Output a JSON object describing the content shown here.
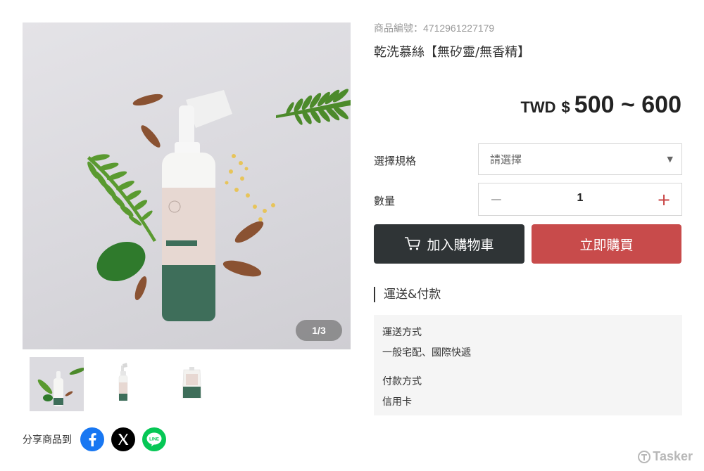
{
  "gallery": {
    "counter": "1/3",
    "thumbnails": [
      "product-photo",
      "bottle-photo",
      "refill-pouch-photo"
    ]
  },
  "share": {
    "label": "分享商品到",
    "networks": [
      "facebook",
      "x",
      "line"
    ]
  },
  "product": {
    "sku": "商品編號：4712961227179",
    "title": "乾洗慕絲【無矽靈/無香精】",
    "price": {
      "currency": "TWD",
      "symbol": "$",
      "amount": "500 ~ 600"
    }
  },
  "options": {
    "spec_label": "選擇規格",
    "spec_placeholder": "請選擇",
    "qty_label": "數量",
    "qty_value": "1",
    "minus": "−",
    "plus": "+"
  },
  "actions": {
    "add_to_cart": "加入購物車",
    "buy_now": "立即購買"
  },
  "shipping": {
    "section_title": "運送&付款",
    "shipping_method_label": "運送方式",
    "shipping_method_value": "一般宅配、國際快遞",
    "payment_method_label": "付款方式",
    "payment_method_value": "信用卡"
  },
  "watermark": "Tasker",
  "colors": {
    "buy_button": "#c84b4b",
    "cart_button": "#2f3436",
    "plus": "#c84444",
    "facebook": "#1877f2",
    "x": "#000000",
    "line": "#06c755"
  }
}
